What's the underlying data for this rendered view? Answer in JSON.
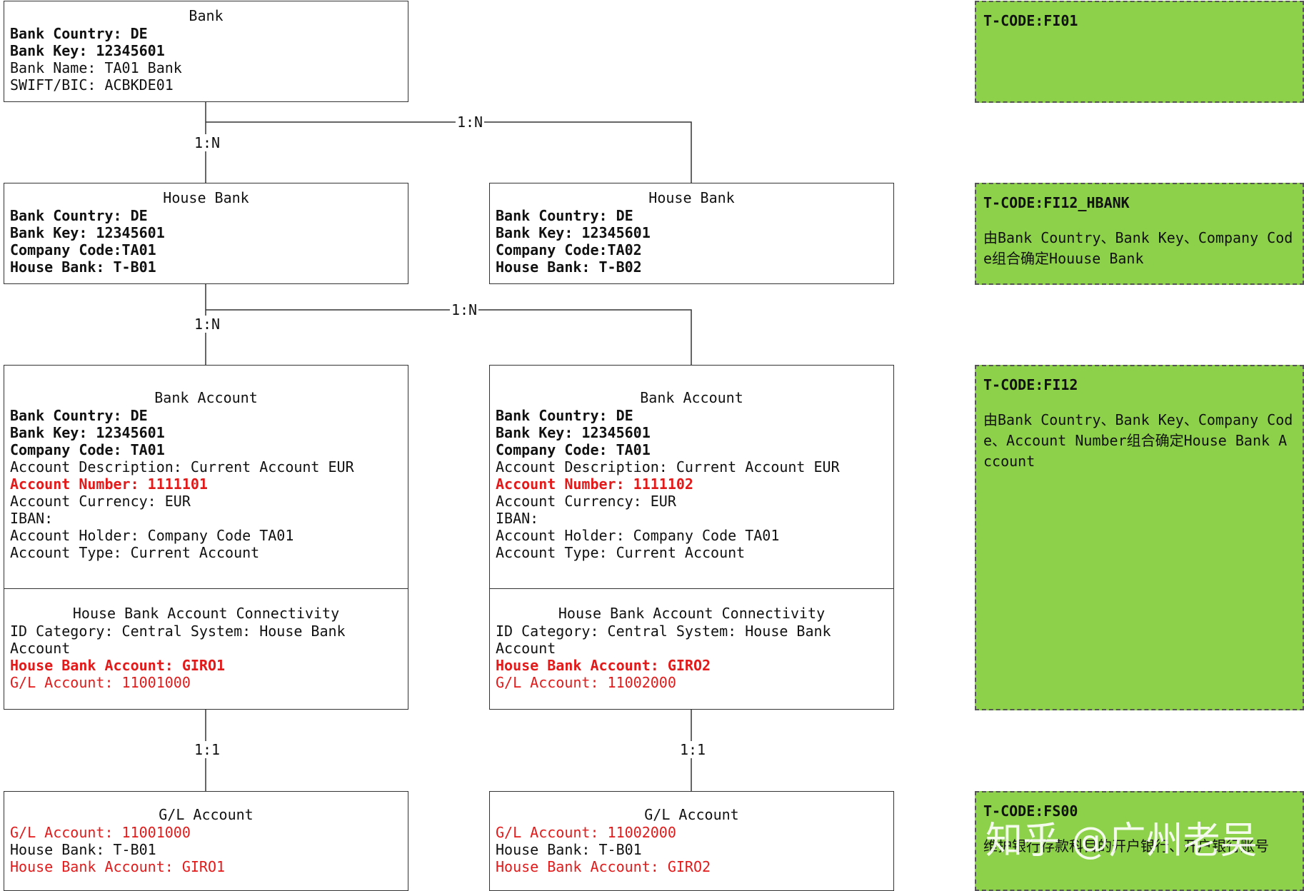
{
  "bank": {
    "title": "Bank",
    "country": "Bank Country: DE",
    "key": "Bank Key: 12345601",
    "name": "Bank Name: TA01 Bank",
    "swift": "SWIFT/BIC: ACBKDE01"
  },
  "house_banks": [
    {
      "title": "House Bank",
      "country": "Bank Country: DE",
      "key": "Bank Key: 12345601",
      "company": "Company Code:TA01",
      "house_bank": "House Bank: T-B01"
    },
    {
      "title": "House Bank",
      "country": "Bank Country: DE",
      "key": "Bank Key: 12345601",
      "company": "Company Code:TA02",
      "house_bank": "House Bank: T-B02"
    }
  ],
  "bank_accounts": [
    {
      "title": "Bank Account",
      "country": "Bank Country: DE",
      "key": "Bank Key: 12345601",
      "company": "Company Code: TA01",
      "description": "Account Description: Current Account EUR",
      "number": "Account Number: 1111101",
      "currency": "Account Currency: EUR",
      "iban": "IBAN:",
      "holder": "Account Holder: Company Code TA01",
      "type": "Account Type: Current Account",
      "conn_title": "House Bank Account Connectivity",
      "id_category": "ID Category: Central System: House Bank Account",
      "hb_account": "House Bank Account: GIRO1",
      "gl_account": "G/L Account: 11001000"
    },
    {
      "title": "Bank Account",
      "country": "Bank Country: DE",
      "key": "Bank Key: 12345601",
      "company": "Company Code: TA01",
      "description": "Account Description: Current Account EUR",
      "number": "Account Number: 1111102",
      "currency": "Account Currency: EUR",
      "iban": "IBAN:",
      "holder": "Account Holder: Company Code TA01",
      "type": "Account Type: Current Account",
      "conn_title": "House Bank Account Connectivity",
      "id_category": "ID Category: Central System: House Bank Account",
      "hb_account": "House Bank Account: GIRO2",
      "gl_account": "G/L Account: 11002000"
    }
  ],
  "gl_accounts": [
    {
      "title": "G/L Account",
      "gl": "G/L Account: 11001000",
      "house_bank": "House Bank: T-B01",
      "hb_account": "House Bank Account: GIRO1"
    },
    {
      "title": "G/L Account",
      "gl": "G/L Account: 11002000",
      "house_bank": "House Bank: T-B01",
      "hb_account": "House Bank Account: GIRO2"
    }
  ],
  "relations": {
    "bank_hb_left": "1:N",
    "bank_hb_right": "1:N",
    "hb_acc_left": "1:N",
    "hb_acc_right": "1:N",
    "acc_gl_left": "1:1",
    "acc_gl_right": "1:1"
  },
  "notes": [
    {
      "code": "T-CODE:FI01",
      "desc": ""
    },
    {
      "code": "T-CODE:FI12_HBANK",
      "desc": "由Bank Country、Bank Key、Company Code组合确定Houuse Bank"
    },
    {
      "code": "T-CODE:FI12",
      "desc": "由Bank Country、Bank Key、Company Code、Account Number组合确定House Bank Account"
    },
    {
      "code": "T-CODE:FS00",
      "desc": "维护银行存款科目的开户银行、开户银行账号"
    }
  ],
  "watermark": "知乎 @广州老吴",
  "colors": {
    "note_green": "#8dd14a",
    "highlight_red": "#e31a1a"
  }
}
